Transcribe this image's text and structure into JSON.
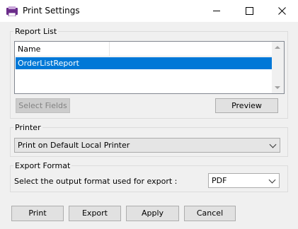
{
  "window": {
    "title": "Print Settings"
  },
  "report_list": {
    "legend": "Report List",
    "column_header": "Name",
    "items": [
      "OrderListReport"
    ],
    "select_fields_label": "Select Fields",
    "preview_label": "Preview"
  },
  "printer": {
    "legend": "Printer",
    "selected": "Print on Default Local Printer"
  },
  "export": {
    "legend": "Export Format",
    "label": "Select the output format used for export :",
    "selected": "PDF"
  },
  "footer": {
    "print_label": "Print",
    "export_label": "Export",
    "apply_label": "Apply",
    "cancel_label": "Cancel"
  },
  "colors": {
    "selection": "#0078d7",
    "background": "#f0f0f0"
  },
  "icons": {
    "app": "printer-settings-app-icon",
    "minimize": "minimize-icon",
    "maximize": "maximize-icon",
    "close": "close-icon"
  }
}
